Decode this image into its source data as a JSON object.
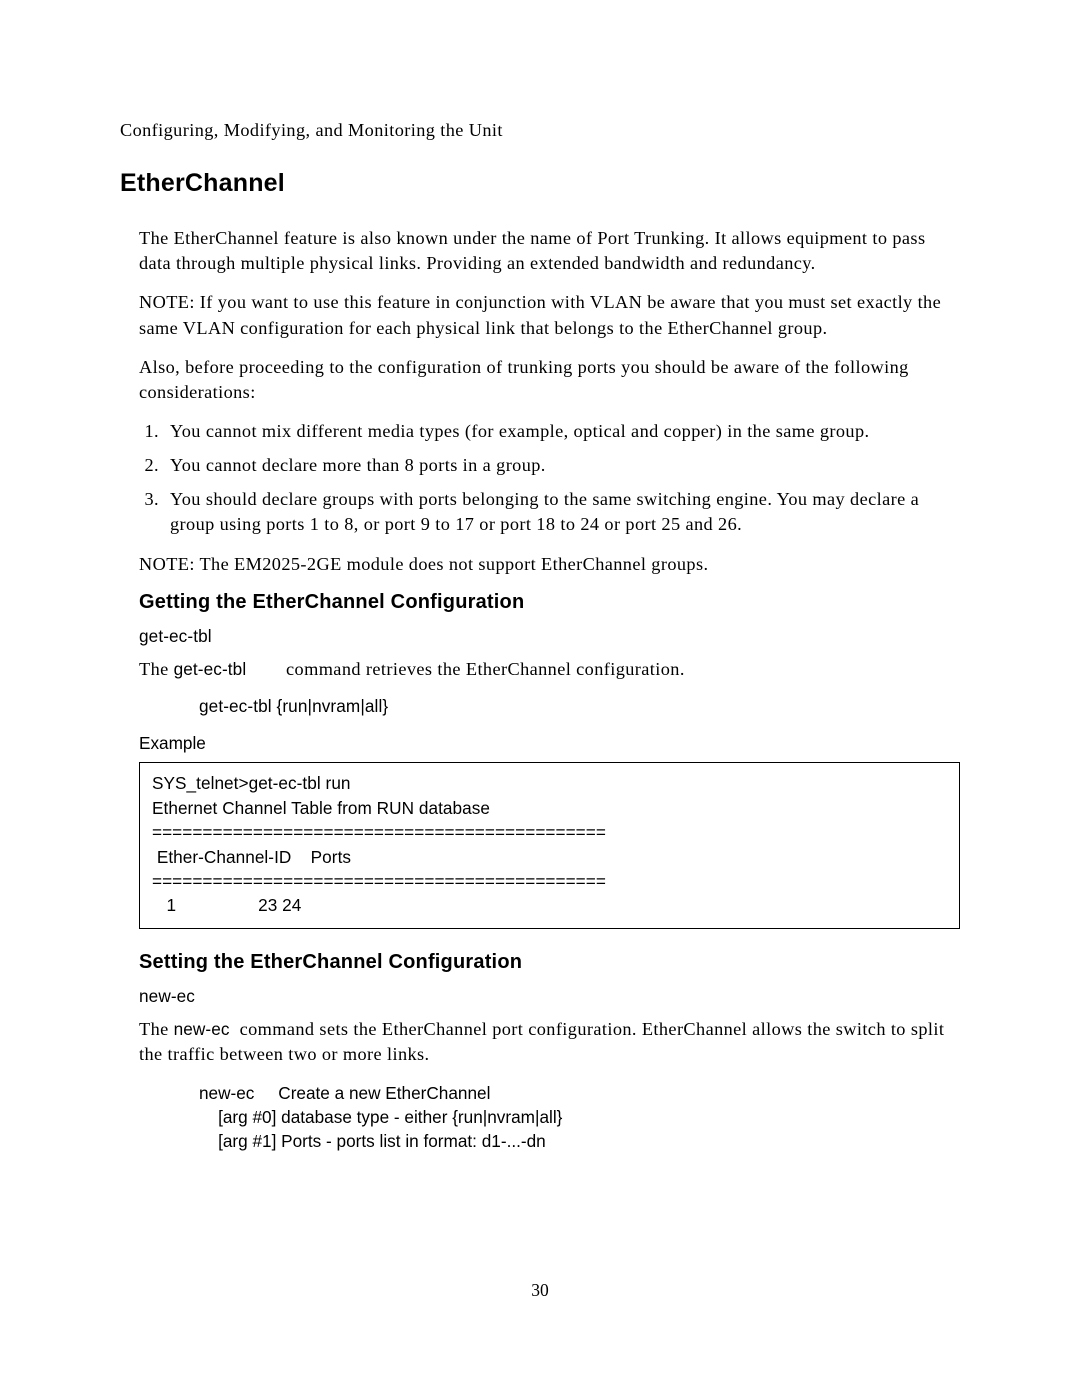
{
  "header": {
    "running_title": "Configuring, Modifying, and Monitoring the Unit"
  },
  "h1": "EtherChannel",
  "paras": {
    "intro1": "The EtherChannel feature is also known under the name of Port Trunking.  It allows equipment to pass data through multiple physical links.  Providing an extended bandwidth and redundancy.",
    "note1": "NOTE:  If you want to use this feature in conjunction with VLAN be aware that you must set exactly the same VLAN configuration for each physical link that belongs to the EtherChannel group.",
    "intro2": "Also, before proceeding to the configuration of trunking ports you should be aware of the following considerations:",
    "note2": "NOTE:  The EM2025-2GE module does not support EtherChannel groups."
  },
  "list_items": [
    "You cannot mix different media types (for example, optical and copper) in the same group.",
    "You cannot declare more than 8 ports in a group.",
    "You should declare groups with ports belonging to the same switching engine.  You may declare a group using ports 1 to 8, or port 9 to 17 or port 18 to 24 or port 25 and 26."
  ],
  "getting": {
    "heading": "Getting the EtherChannel Configuration",
    "cmd_name": "get-ec-tbl",
    "desc_prefix": "The ",
    "desc_cmd": "get-ec-tbl",
    "desc_suffix": " command retrieves the EtherChannel configuration.",
    "syntax": "get-ec-tbl {run|nvram|all}",
    "example_label": "Example",
    "example_text": "SYS_telnet>get-ec-tbl run\nEthernet Channel Table from RUN database\n=============================================\n Ether-Channel-ID    Ports\n=============================================\n   1                 23 24"
  },
  "setting": {
    "heading": "Setting the EtherChannel Configuration",
    "cmd_name": "new-ec",
    "desc_prefix": "The ",
    "desc_cmd": "new-ec",
    "desc_suffix": " command sets the EtherChannel port configuration.  EtherChannel allows the switch to split the traffic between two or more links.",
    "syntax": "new-ec     Create a new EtherChannel\n    [arg #0] database type - either {run|nvram|all}\n    [arg #1] Ports - ports list in format: d1-...-dn"
  },
  "page_number": "30"
}
